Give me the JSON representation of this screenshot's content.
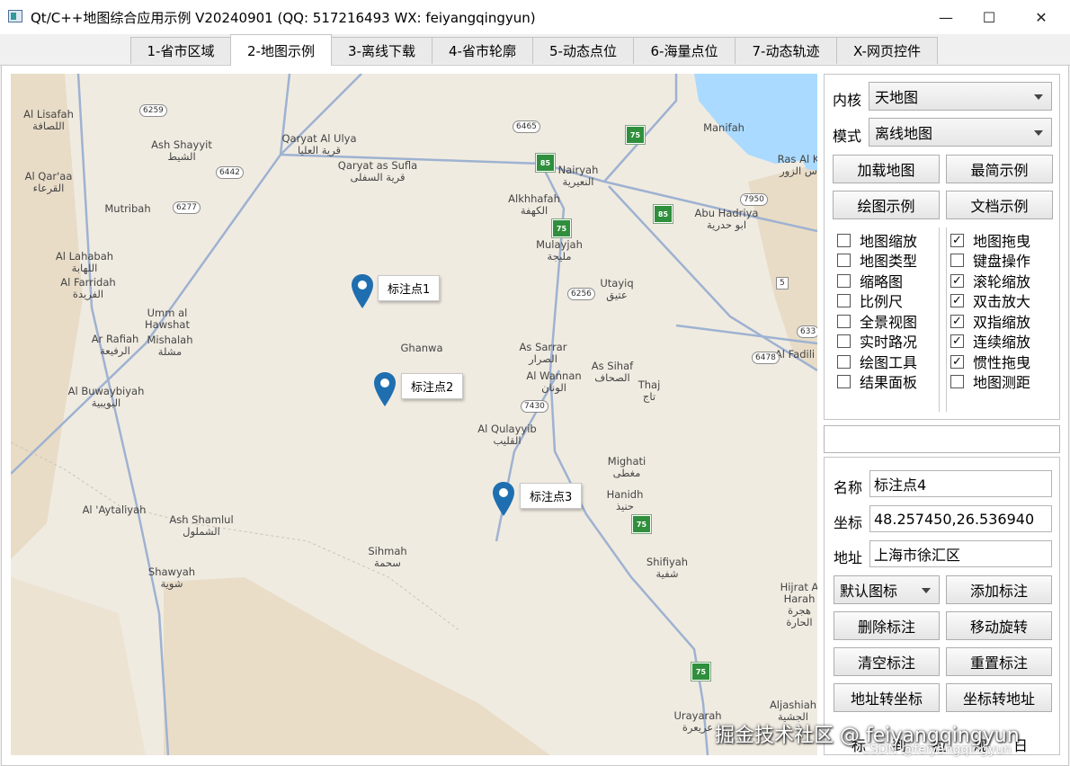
{
  "window": {
    "title": "Qt/C++地图综合应用示例 V20240901 (QQ: 517216493 WX: feiyangqingyun)",
    "minimize": "—",
    "maximize": "☐",
    "close": "✕"
  },
  "tabs": [
    {
      "label": "1-省市区域"
    },
    {
      "label": "2-地图示例",
      "active": true
    },
    {
      "label": "3-离线下载"
    },
    {
      "label": "4-省市轮廓"
    },
    {
      "label": "5-动态点位"
    },
    {
      "label": "6-海量点位"
    },
    {
      "label": "7-动态轨迹"
    },
    {
      "label": "X-网页控件"
    }
  ],
  "map": {
    "places": [
      {
        "en": "Al Lisafah",
        "ar": "اللصافة"
      },
      {
        "en": "Ash Shayyit",
        "ar": "الشيط"
      },
      {
        "en": "Qaryat Al Ulya",
        "ar": "قرية العليا"
      },
      {
        "en": "Qaryat as Sufla",
        "ar": "قرية السفلى"
      },
      {
        "en": "Al Qar'aa",
        "ar": "القرعاء"
      },
      {
        "en": "Mutribah",
        "ar": ""
      },
      {
        "en": "Nairyah",
        "ar": "النعيرية"
      },
      {
        "en": "Manifah",
        "ar": ""
      },
      {
        "en": "Ras Al K",
        "ar": "س الزور"
      },
      {
        "en": "Alkhhafah",
        "ar": "الكهفة"
      },
      {
        "en": "Abu Hadriya",
        "ar": "ابو حدرية"
      },
      {
        "en": "Mulayjah",
        "ar": "مليجة"
      },
      {
        "en": "Al Lahabah",
        "ar": "اللهابة"
      },
      {
        "en": "Al Farridah",
        "ar": "الفريدة"
      },
      {
        "en": "Utayiq",
        "ar": "عتيق"
      },
      {
        "en": "Umm al Hawshat",
        "ar": ""
      },
      {
        "en": "Ar Rafiah",
        "ar": "الرفيعة"
      },
      {
        "en": "Mishalah",
        "ar": "مشلة"
      },
      {
        "en": "Ghanwa",
        "ar": ""
      },
      {
        "en": "As Sarrar",
        "ar": "الصرار"
      },
      {
        "en": "Al Fadili",
        "ar": ""
      },
      {
        "en": "Al Wannan",
        "ar": "الونان"
      },
      {
        "en": "As Sihaf",
        "ar": "الصحاف"
      },
      {
        "en": "Al Buwaybiyah",
        "ar": "البويبية"
      },
      {
        "en": "Thaj",
        "ar": "تاج"
      },
      {
        "en": "Al Qulayyib",
        "ar": "القليب"
      },
      {
        "en": "Mighati",
        "ar": "مغطى"
      },
      {
        "en": "Hanidh",
        "ar": "حنيذ"
      },
      {
        "en": "Al 'Aytaliyah",
        "ar": ""
      },
      {
        "en": "Ash Shamlul",
        "ar": "الشملول"
      },
      {
        "en": "Sihmah",
        "ar": "سحمة"
      },
      {
        "en": "Shifiyah",
        "ar": "شفية"
      },
      {
        "en": "Shawyah",
        "ar": "شوية"
      },
      {
        "en": "Hijrat A Harah",
        "ar": "هجرة الحارة"
      },
      {
        "en": "Aljashiah",
        "ar": "الجشية"
      },
      {
        "en": "Urayarah",
        "ar": "عريعرة"
      }
    ],
    "road_numbers": [
      "6259",
      "6465",
      "6442",
      "6277",
      "7950",
      "6256",
      "6478",
      "7430",
      "633",
      "5"
    ],
    "shields": [
      "75",
      "85",
      "85",
      "75",
      "75",
      "75"
    ],
    "markers": [
      {
        "label": "标注点1"
      },
      {
        "label": "标注点2"
      },
      {
        "label": "标注点3"
      }
    ],
    "marker_color": "#1f6fb0",
    "water_color": "#aadaff",
    "road_color": "#9eb2d1"
  },
  "controls": {
    "kernel_label": "内核",
    "kernel_value": "天地图",
    "mode_label": "模式",
    "mode_value": "离线地图",
    "buttons_top": [
      "加载地图",
      "最简示例",
      "绘图示例",
      "文档示例"
    ],
    "checks_left": [
      {
        "label": "地图缩放",
        "checked": false
      },
      {
        "label": "地图类型",
        "checked": false
      },
      {
        "label": "缩略图",
        "checked": false
      },
      {
        "label": "比例尺",
        "checked": false
      },
      {
        "label": "全景视图",
        "checked": false
      },
      {
        "label": "实时路况",
        "checked": false
      },
      {
        "label": "绘图工具",
        "checked": false
      },
      {
        "label": "结果面板",
        "checked": false
      }
    ],
    "checks_right": [
      {
        "label": "地图拖曳",
        "checked": true
      },
      {
        "label": "键盘操作",
        "checked": false
      },
      {
        "label": "滚轮缩放",
        "checked": true
      },
      {
        "label": "双击放大",
        "checked": true
      },
      {
        "label": "双指缩放",
        "checked": true
      },
      {
        "label": "连续缩放",
        "checked": true
      },
      {
        "label": "惯性拖曳",
        "checked": true
      },
      {
        "label": "地图测距",
        "checked": false
      }
    ],
    "empty_input": "",
    "name_label": "名称",
    "name_value": "标注点4",
    "coord_label": "坐标",
    "coord_value": "48.257450,26.536940",
    "addr_label": "地址",
    "addr_value": "上海市徐汇区",
    "icon_select": "默认图标",
    "buttons_bottom": [
      "添加标注",
      "删除标注",
      "移动旋转",
      "清空标注",
      "重置标注",
      "地址转坐标",
      "坐标转地址"
    ],
    "bottom_row_fragments": [
      "标",
      "到",
      "拉",
      "规",
      "日"
    ]
  },
  "watermarks": {
    "juejin": "掘金技术社区 @ feiyangqingyun",
    "csdn": "CSDN @feiyangqingyun"
  }
}
